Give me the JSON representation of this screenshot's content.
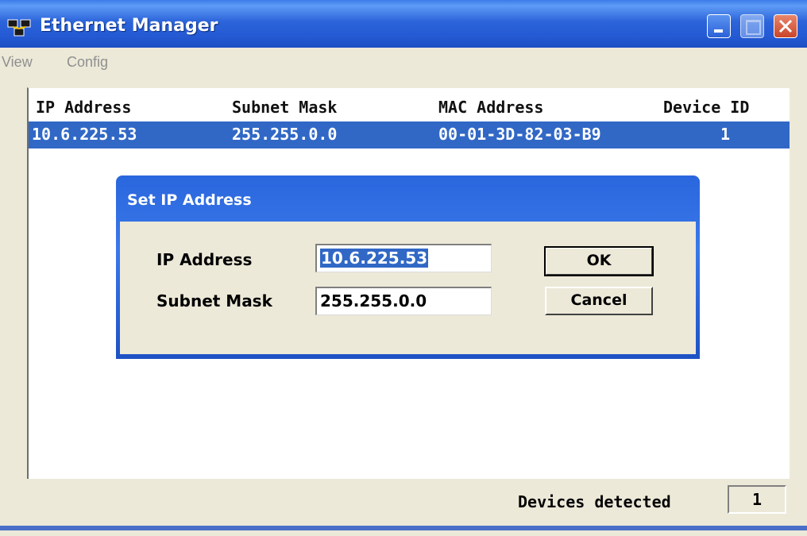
{
  "window": {
    "title": "Ethernet Manager",
    "icon": "network-devices-icon"
  },
  "menu": {
    "items": [
      "View",
      "Config"
    ]
  },
  "table": {
    "columns": [
      "IP Address",
      "Subnet Mask",
      "MAC Address",
      "Device ID"
    ],
    "rows": [
      {
        "ip": "10.6.225.53",
        "mask": "255.255.0.0",
        "mac": "00-01-3D-82-03-B9",
        "id": "1",
        "selected": true
      }
    ]
  },
  "dialog": {
    "title": "Set IP Address",
    "ip_label": "IP Address",
    "ip_value": "10.6.225.53",
    "mask_label": "Subnet Mask",
    "mask_value": "255.255.0.0",
    "ok_label": "OK",
    "cancel_label": "Cancel"
  },
  "status": {
    "devices_label": "Devices detected",
    "devices_count": "1"
  },
  "colors": {
    "titlebar": "#245ad4",
    "selection": "#3168c6",
    "face": "#ece9d8"
  }
}
